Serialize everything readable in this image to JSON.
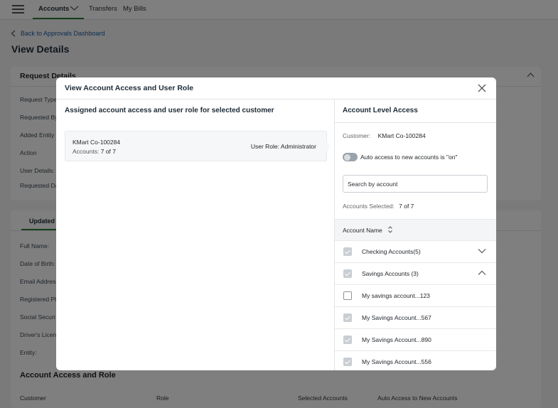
{
  "nav": {
    "tabs": [
      {
        "label": "Accounts"
      },
      {
        "label": "Transfers"
      },
      {
        "label": "My Bills"
      }
    ]
  },
  "page": {
    "back_link": "Back to Approvals Dashboard",
    "title": "View Details"
  },
  "request_details": {
    "title": "Request Details",
    "labels": [
      "Request Type",
      "Requested By",
      "Added Entity",
      "Action",
      "User Details:",
      "Requested Da"
    ]
  },
  "updated_section": {
    "tab_label": "Updated",
    "labels": [
      "Full Name:",
      "Date of Birth:",
      "Email Address",
      "Registered Ph",
      "Social Securi",
      "Driver's Licen",
      "Entity:"
    ]
  },
  "account_access_role": {
    "title": "Account Access and Role",
    "columns": [
      "Customer",
      "Role",
      "Selected Accounts",
      "Auto Access to New Accounts"
    ]
  },
  "modal": {
    "title": "View Account Access and User Role",
    "left_heading": "Assigned account access and user role for selected customer",
    "customer_card": {
      "name": "KMart Co-100284",
      "accounts_label": "Accounts:",
      "accounts_value": "7 of 7",
      "role_label": "User Role:",
      "role_value": "Administrator"
    },
    "right_heading": "Account Level Access",
    "customer_label": "Customer:",
    "customer_value": "KMart Co-100284",
    "auto_access_text": "Auto access to new accounts is \"on\"",
    "auto_access_on": true,
    "search_placeholder": "Search by account",
    "accounts_selected_label": "Accounts Selected:",
    "accounts_selected_value": "7 of 7",
    "table_header": "Account Name",
    "rows": [
      {
        "label": "Checking Accounts(5)",
        "checked": true,
        "group": true,
        "expanded": false
      },
      {
        "label": "Savings Accounts (3)",
        "checked": true,
        "group": true,
        "expanded": true
      },
      {
        "label": "My savings account...123",
        "checked": false
      },
      {
        "label": "My Savings Account...567",
        "checked": true
      },
      {
        "label": "My Savings Account...890",
        "checked": true
      },
      {
        "label": "My Savings Account...556",
        "checked": true
      }
    ]
  },
  "colors": {
    "accent_green": "#2e7d32",
    "link_blue": "#1a5a9c",
    "overlay": "rgba(0,0,0,0.5)"
  }
}
